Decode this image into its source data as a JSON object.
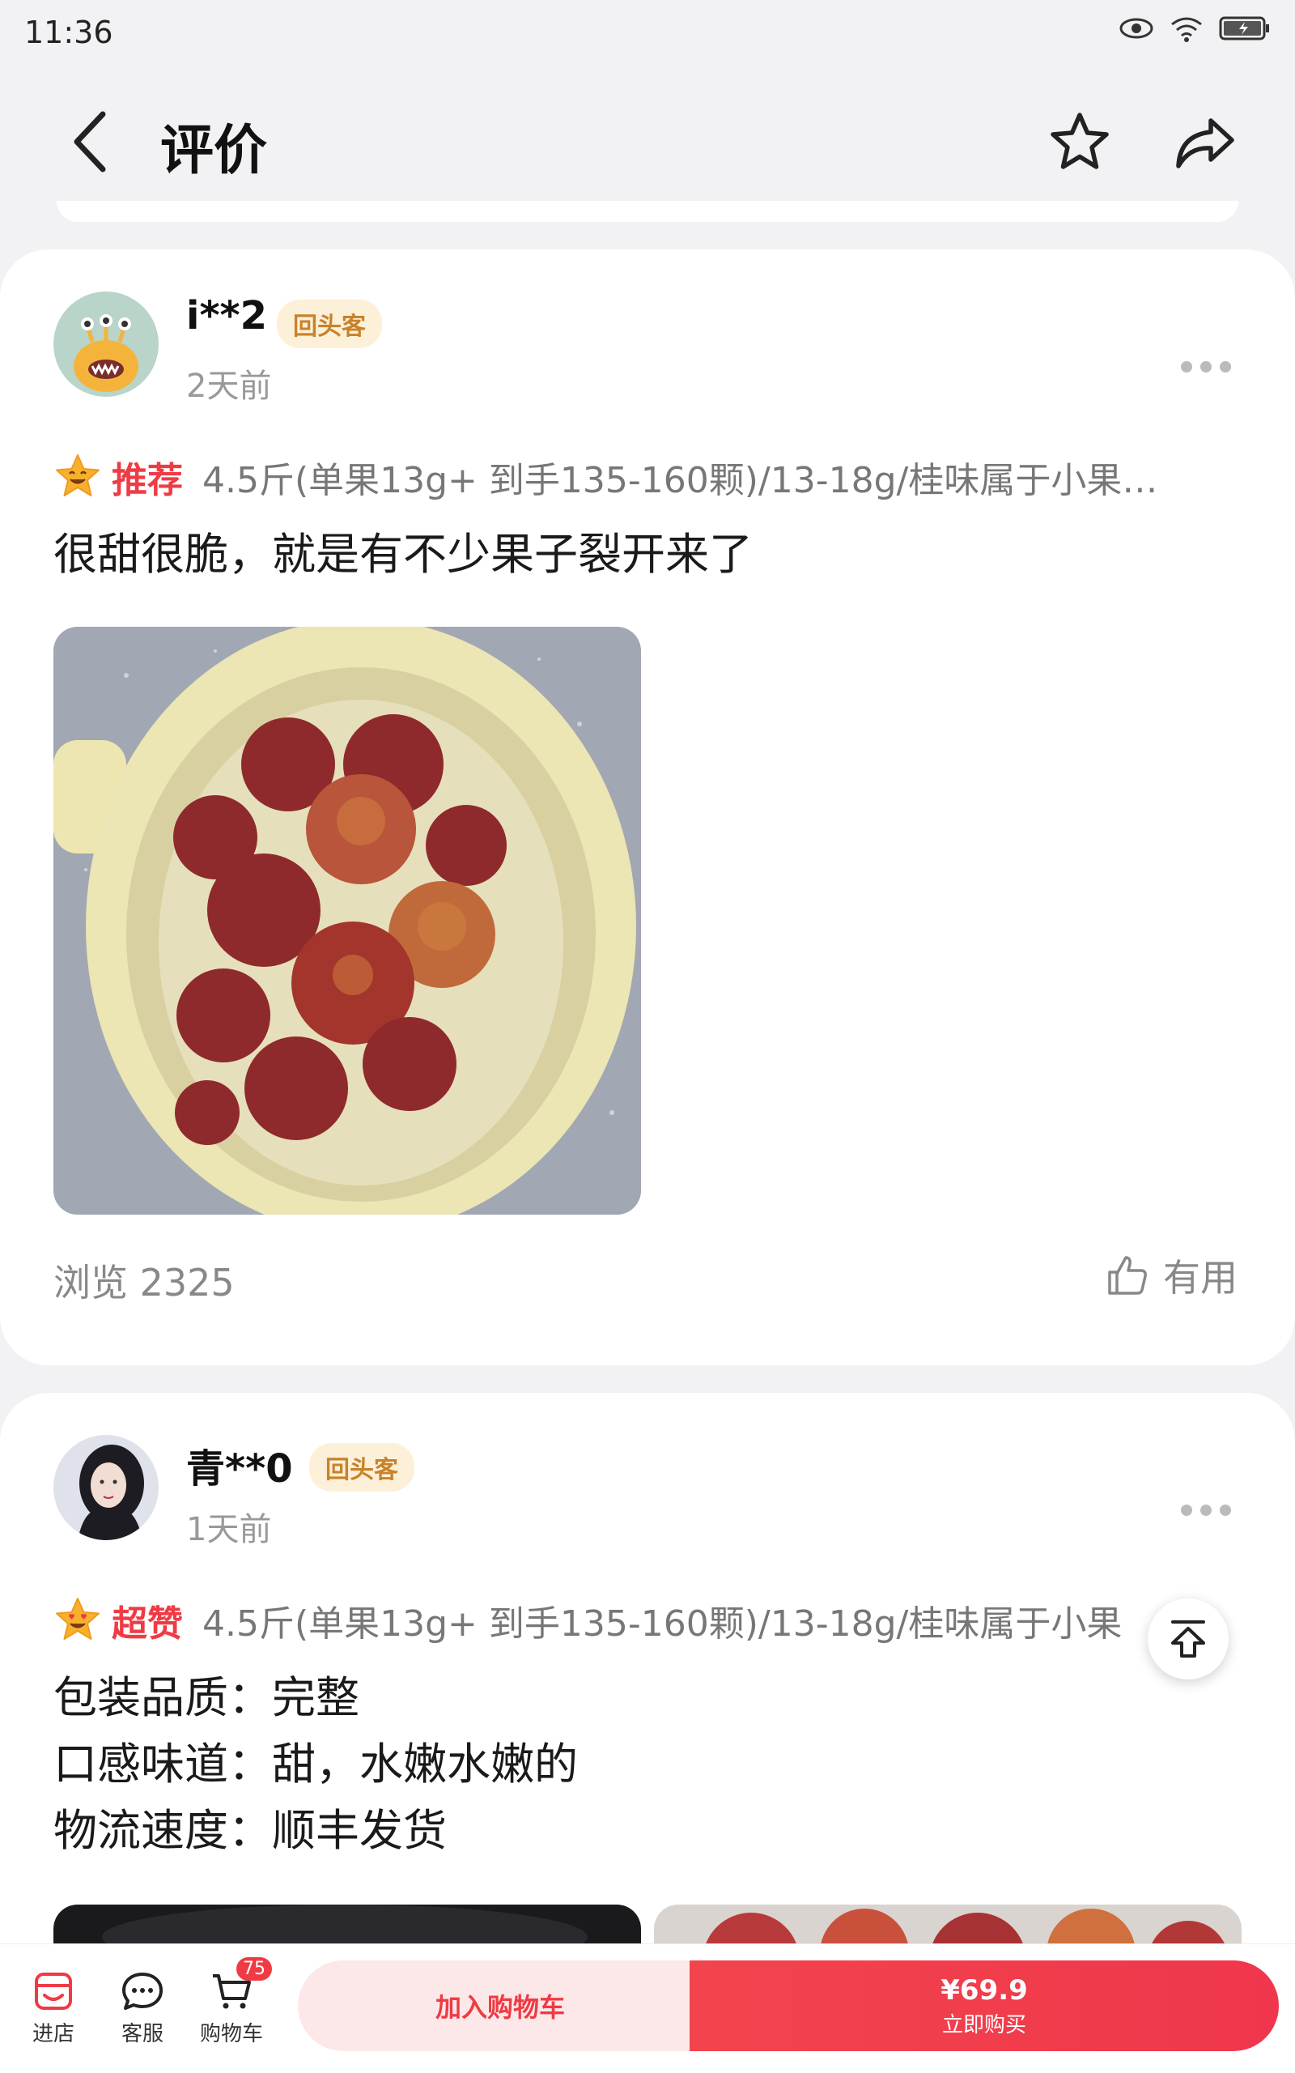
{
  "status_bar": {
    "time": "11:36"
  },
  "header": {
    "title": "评价"
  },
  "reviews": [
    {
      "username": "i**2",
      "badge": "回头客",
      "time": "2天前",
      "rating_label": "推荐",
      "sku": "4.5斤(单果13g+ 到手135-160颗)/13-18g/桂味属于小果…",
      "lines": [
        "很甜很脆，就是有不少果子裂开来了"
      ],
      "views_label": "浏览 2325",
      "useful_label": "有用"
    },
    {
      "username": "青**0",
      "badge": "回头客",
      "time": "1天前",
      "rating_label": "超赞",
      "sku": "4.5斤(单果13g+ 到手135-160颗)/13-18g/桂味属于小果",
      "lines": [
        "包装品质：完整",
        "口感味道：甜，水嫩水嫩的",
        "物流速度：顺丰发货"
      ]
    }
  ],
  "bottom_bar": {
    "shop_label": "进店",
    "service_label": "客服",
    "cart_label": "购物车",
    "cart_count": "75",
    "add_to_cart_label": "加入购物车",
    "price": "¥69.9",
    "buy_now_label": "立即购买"
  },
  "colors": {
    "accent_red": "#ef3b44",
    "badge_gold": "#c8822a",
    "badge_bg": "#fdf0d8"
  }
}
